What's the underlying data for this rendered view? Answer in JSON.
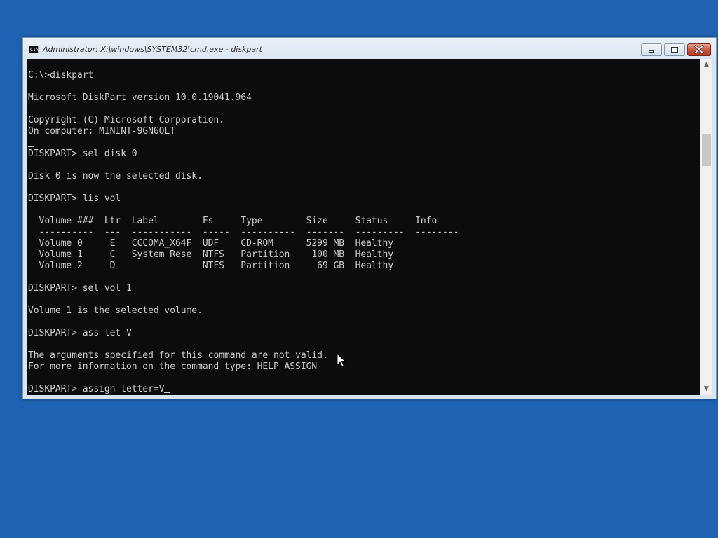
{
  "window": {
    "title": "Administrator: X:\\windows\\SYSTEM32\\cmd.exe - diskpart",
    "icon_text": "C:\\"
  },
  "icons": {
    "app_icon": "cmd-icon",
    "minimize": "minimize-icon",
    "maximize": "maximize-icon",
    "close": "close-icon",
    "scroll_up": "chevron-up-icon",
    "scroll_down": "chevron-down-icon",
    "pointer": "mouse-pointer-icon"
  },
  "colors": {
    "desktop": "#1d62b3",
    "console_bg": "#0c0c0c",
    "console_text": "#cccccc",
    "close_button": "#c9503a"
  },
  "scroll_arrows": {
    "up": "▲",
    "down": "▼"
  },
  "console": {
    "lines": [
      "C:\\>diskpart",
      "",
      "Microsoft DiskPart version 10.0.19041.964",
      "",
      "Copyright (C) Microsoft Corporation.",
      "On computer: MININT-9GN6OLT",
      "",
      "DISKPART> sel disk 0",
      "",
      "Disk 0 is now the selected disk.",
      "",
      "DISKPART> lis vol",
      "",
      "  Volume ###  Ltr  Label        Fs     Type        Size     Status     Info",
      "  ----------  ---  -----------  -----  ----------  -------  ---------  --------",
      "  Volume 0     E   CCCOMA_X64F  UDF    CD-ROM      5299 MB  Healthy",
      "  Volume 1     C   System Rese  NTFS   Partition    100 MB  Healthy",
      "  Volume 2     D                NTFS   Partition     69 GB  Healthy",
      "",
      "DISKPART> sel vol 1",
      "",
      "Volume 1 is the selected volume.",
      "",
      "DISKPART> ass let V",
      "",
      "The arguments specified for this command are not valid.",
      "For more information on the command type: HELP ASSIGN",
      "",
      "DISKPART> assign letter=V"
    ]
  }
}
